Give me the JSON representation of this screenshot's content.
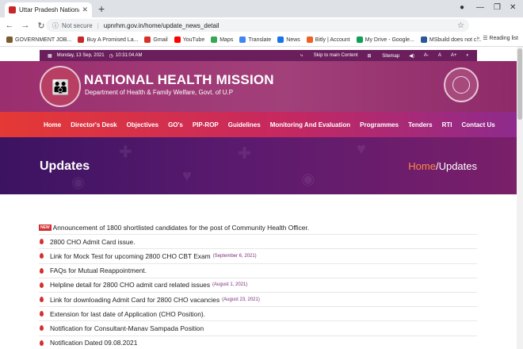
{
  "browser": {
    "tab_title": "Uttar Pradesh National Health M",
    "security_label": "Not secure",
    "url": "upnrhm.gov.in/home/update_news_detail",
    "reading_list": "Reading list",
    "bookmarks": [
      {
        "label": "GOVERNMENT JOB...",
        "color": "#7b5a2e"
      },
      {
        "label": "Buy A Promised La...",
        "color": "#c62828"
      },
      {
        "label": "Gmail",
        "color": "#d93025"
      },
      {
        "label": "YouTube",
        "color": "#ff0000"
      },
      {
        "label": "Maps",
        "color": "#34a853"
      },
      {
        "label": "Translate",
        "color": "#4285f4"
      },
      {
        "label": "News",
        "color": "#1a73e8"
      },
      {
        "label": "Bitly | Account",
        "color": "#ee6123"
      },
      {
        "label": "My Drive - Google...",
        "color": "#0f9d58"
      },
      {
        "label": "MSbuild does not c...",
        "color": "#2b579a"
      }
    ]
  },
  "site": {
    "topbar": {
      "date": "Monday, 13 Sep, 2021",
      "time": "10:31:04 AM",
      "skip": "Skip to main Content",
      "sitemap": "Sitemap",
      "font_small": "A-",
      "font_normal": "A",
      "font_large": "A+"
    },
    "brand": {
      "title": "NATIONAL HEALTH MISSION",
      "subtitle": "Department of Health & Family Welfare, Govt. of U.P"
    },
    "nav": [
      "Home",
      "Director's Desk",
      "Objectives",
      "GO's",
      "PIP-ROP",
      "Guidelines",
      "Monitoring And Evaluation",
      "Programmes",
      "Tenders",
      "RTI",
      "Contact Us"
    ],
    "banner": {
      "title": "Updates",
      "crumb_home": "Home",
      "crumb_sep": "/",
      "crumb_current": "Updates"
    },
    "new_badge": "NEW",
    "updates": [
      {
        "text": "Announcement of 1800 shortlisted candidates for the post of Community Health Officer.",
        "date": "",
        "is_new": true
      },
      {
        "text": "2800 CHO Admit Card issue.",
        "date": "",
        "is_new": false
      },
      {
        "text": "Link for Mock Test for upcoming 2800 CHO CBT Exam",
        "date": "(September 6, 2021)",
        "is_new": false
      },
      {
        "text": "FAQs for Mutual Reappointment.",
        "date": "",
        "is_new": false
      },
      {
        "text": "Helpline detail for 2800 CHO admit card related issues",
        "date": "(August 1, 2021)",
        "is_new": false
      },
      {
        "text": "Link for downloading Admit Card for 2800 CHO vacancies",
        "date": "(August 23, 2021)",
        "is_new": false
      },
      {
        "text": "Extension for last date of Application (CHO Position).",
        "date": "",
        "is_new": false
      },
      {
        "text": "Notification for Consultant-Manav Sampada Position",
        "date": "",
        "is_new": false
      },
      {
        "text": "Notification Dated 09.08.2021",
        "date": "",
        "is_new": false
      }
    ]
  }
}
